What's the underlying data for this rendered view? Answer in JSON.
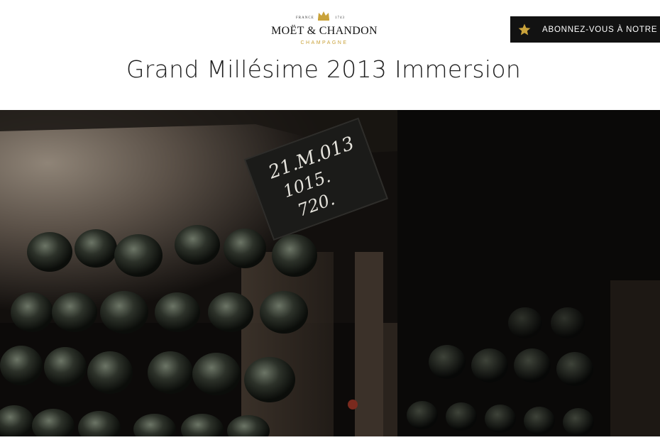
{
  "header": {
    "logo": {
      "top_left": "FRANCE",
      "top_right": "1743",
      "brand": "MOËT & CHANDON",
      "sub": "CHAMPAGNE"
    },
    "subscribe": {
      "label": "ABONNEZ-VOUS À NOTRE NEWSLETTER",
      "icon": "star-icon"
    }
  },
  "main": {
    "title": "Grand Millésime 2013 Immersion",
    "hero": {
      "slate_lines": [
        "21.M.013",
        "1015.",
        "720."
      ]
    }
  },
  "colors": {
    "accent_gold": "#c9a23a",
    "button_bg": "#121212",
    "title_text": "#1e1e1e"
  }
}
